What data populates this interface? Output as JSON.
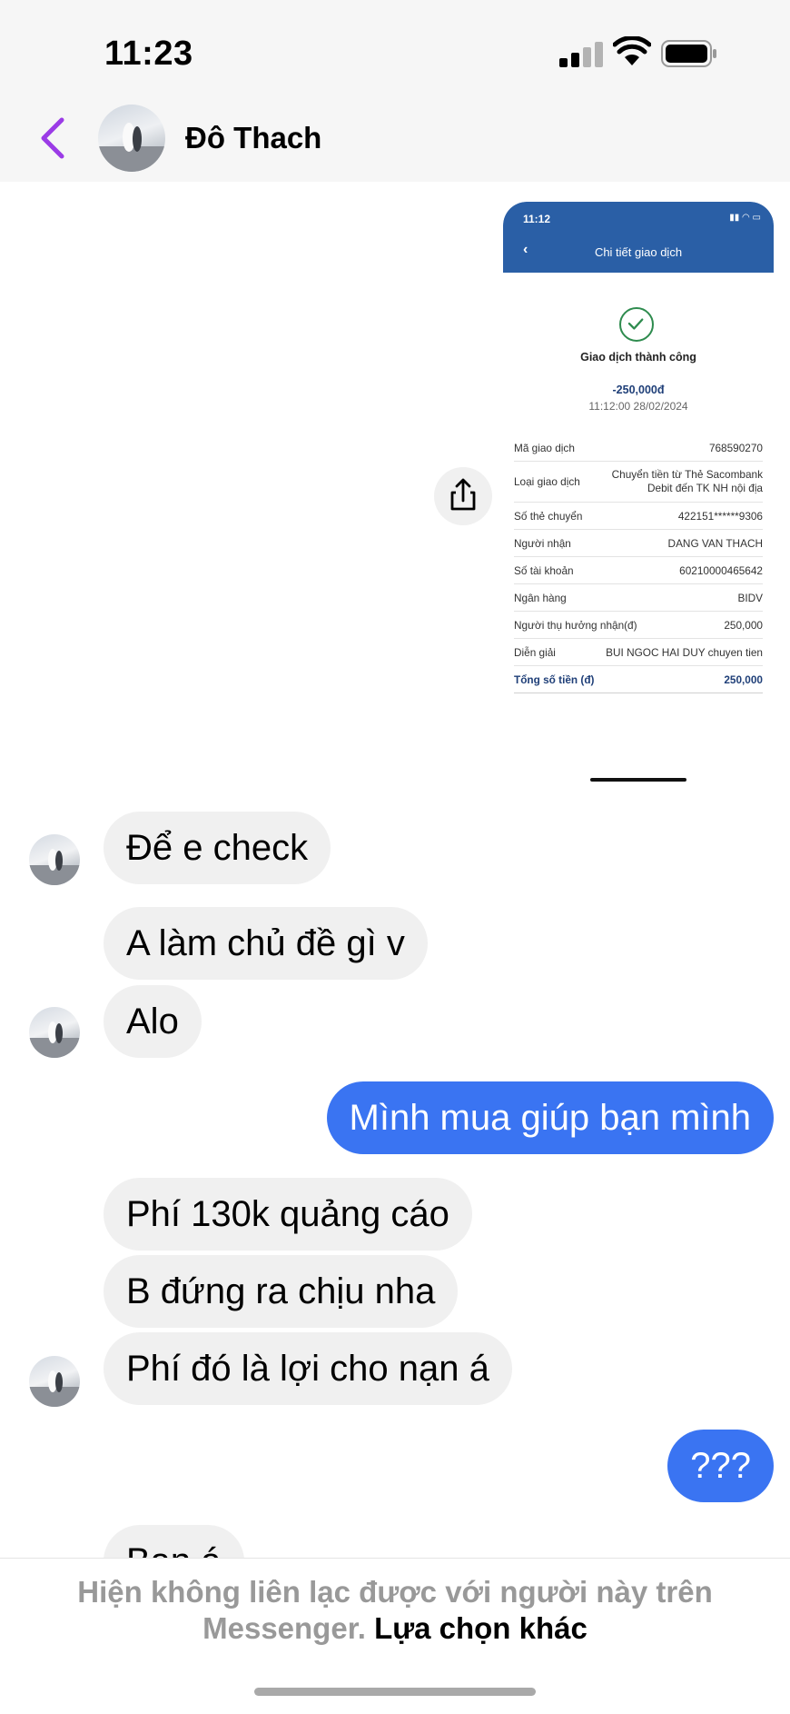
{
  "status_bar": {
    "time": "11:23"
  },
  "header": {
    "contact_name": "Đô Thach"
  },
  "receipt": {
    "time": "11:12",
    "title": "Chi tiết giao dịch",
    "status": "Giao dịch thành công",
    "amount": "-250,000đ",
    "datetime": "11:12:00 28/02/2024",
    "rows": [
      {
        "label": "Mã giao dịch",
        "value": "768590270"
      },
      {
        "label": "Loại giao dịch",
        "value": "Chuyển tiền từ Thẻ Sacombank Debit đến TK NH nội địa"
      },
      {
        "label": "Số thẻ chuyển",
        "value": "422151******9306"
      },
      {
        "label": "Người nhận",
        "value": "DANG VAN THACH"
      },
      {
        "label": "Số tài khoản",
        "value": "60210000465642"
      },
      {
        "label": "Ngân hàng",
        "value": "BIDV"
      },
      {
        "label": "Người thụ hưởng nhận(đ)",
        "value": "250,000"
      },
      {
        "label": "Diễn giải",
        "value": "BUI NGOC HAI DUY chuyen tien"
      },
      {
        "label": "Tổng số tiền (đ)",
        "value": "250,000"
      }
    ]
  },
  "messages": [
    {
      "text": "Để e check"
    },
    {
      "text": "A làm chủ đề gì v"
    },
    {
      "text": "Alo"
    },
    {
      "text": "Mình mua giúp bạn mình"
    },
    {
      "text": "Phí 130k quảng cáo"
    },
    {
      "text": "B đứng ra chịu nha"
    },
    {
      "text": "Phí đó là lợi cho nạn á"
    },
    {
      "text": "???"
    },
    {
      "text": "Bạn á"
    }
  ],
  "footer": {
    "notice": "Hiện không liên lạc được với người này trên Messenger.",
    "link": "Lựa chọn khác"
  },
  "colors": {
    "accent": "#3a74f2",
    "back_arrow": "#9b3be6",
    "bank_header": "#2a5fa6"
  }
}
